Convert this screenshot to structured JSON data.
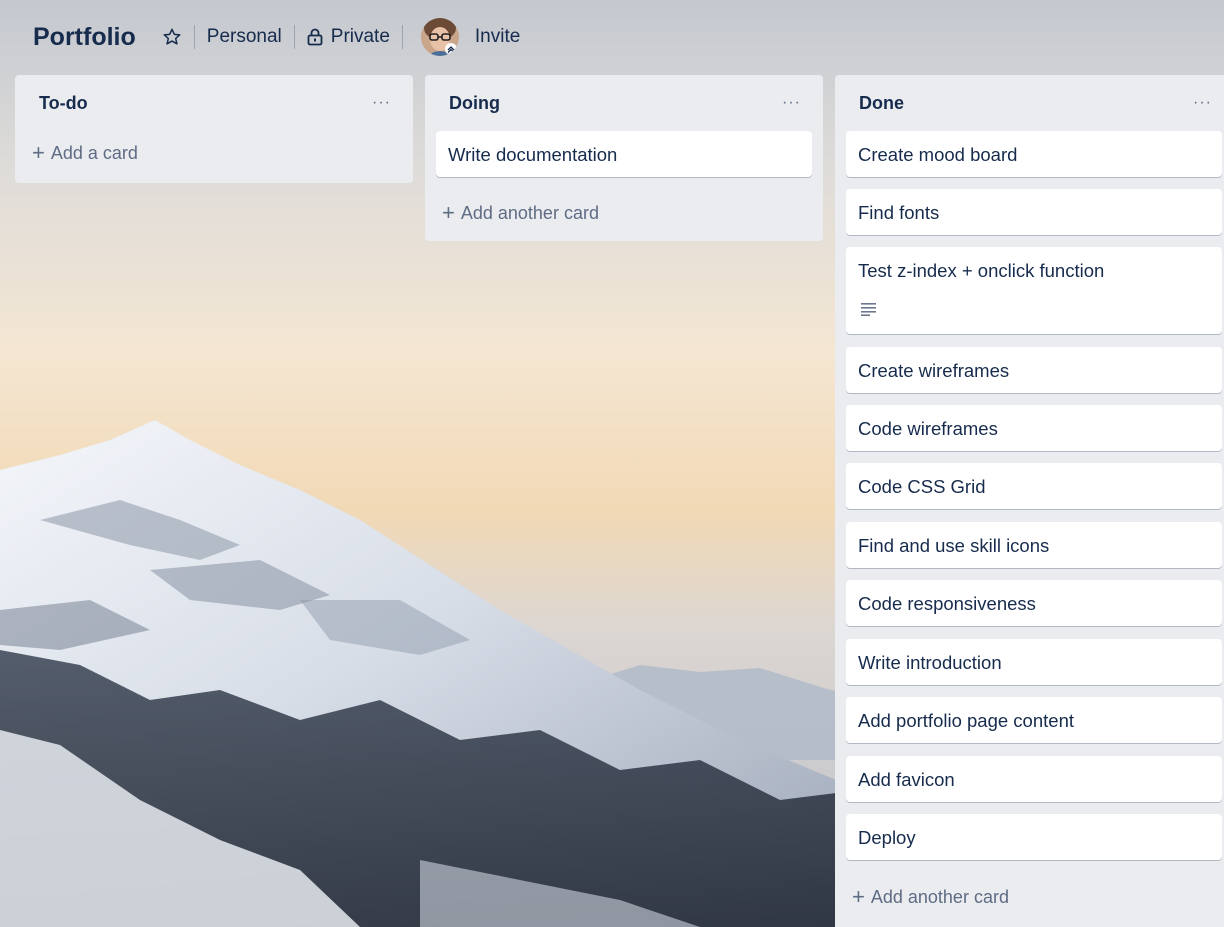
{
  "board": {
    "title": "Portfolio",
    "workspace": "Personal",
    "visibility": "Private",
    "invite_label": "Invite"
  },
  "icons": {
    "star": "star-icon",
    "lock": "lock-icon",
    "menu": "more-dots-icon",
    "description": "description-lines-icon",
    "plus": "plus-icon"
  },
  "lists": [
    {
      "title": "To-do",
      "menu": "···",
      "cards": [],
      "add_label": "Add a card"
    },
    {
      "title": "Doing",
      "menu": "···",
      "cards": [
        "Write documentation"
      ],
      "add_label": "Add another card"
    },
    {
      "title": "Done",
      "menu": "···",
      "cards": [
        "Create mood board",
        "Find fonts",
        "Test z-index + onclick function",
        "Create wireframes",
        "Code wireframes",
        "Code CSS Grid",
        "Find and use skill icons",
        "Code responsiveness",
        "Write introduction",
        "Add portfolio page content",
        "Add favicon",
        "Deploy"
      ],
      "add_label": "Add another card"
    }
  ]
}
